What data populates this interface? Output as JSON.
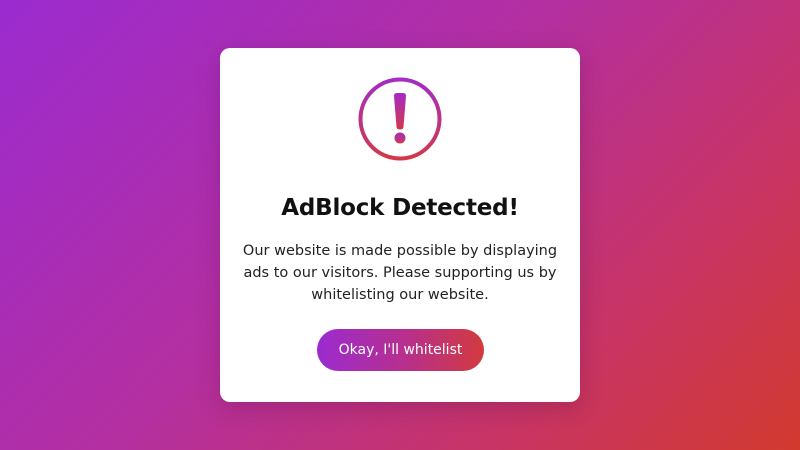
{
  "modal": {
    "title": "AdBlock Detected!",
    "message": "Our website is made possible by displaying ads to our visitors. Please supporting us by whitelisting our website.",
    "button_label": "Okay, I'll whitelist",
    "icon": "exclamation-circle-icon"
  },
  "colors": {
    "gradient_start": "#9b2bd0",
    "gradient_end": "#d23a2e",
    "card_background": "#ffffff",
    "title_text": "#111111"
  }
}
